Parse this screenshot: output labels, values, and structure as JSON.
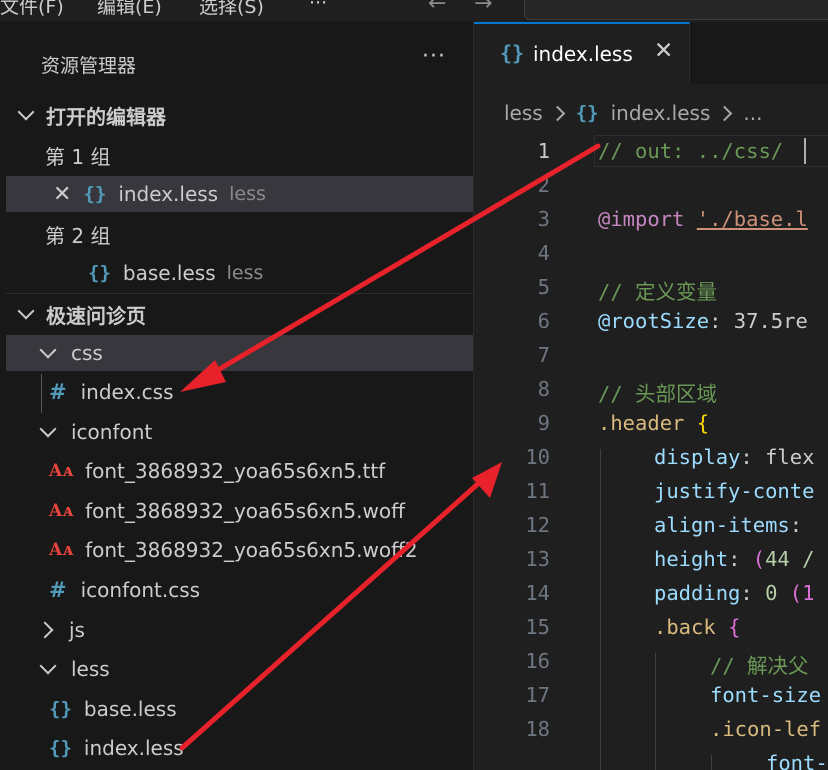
{
  "menubar": {
    "file": "文件(F)",
    "edit": "编辑(E)",
    "selection": "选择(S)",
    "more": "···",
    "back": "←",
    "forward": "→"
  },
  "sidebar": {
    "title": "资源管理器",
    "more": "···",
    "open_editors": {
      "header": "打开的编辑器",
      "group1": "第 1 组",
      "group1_file": {
        "name": "index.less",
        "desc": "less"
      },
      "group2": "第 2 组",
      "group2_file": {
        "name": "base.less",
        "desc": "less"
      }
    },
    "project": {
      "header": "极速问诊页",
      "items": [
        {
          "label": "css"
        },
        {
          "label": "index.css"
        },
        {
          "label": "iconfont"
        },
        {
          "label": "font_3868932_yoa65s6xn5.ttf"
        },
        {
          "label": "font_3868932_yoa65s6xn5.woff"
        },
        {
          "label": "font_3868932_yoa65s6xn5.woff2"
        },
        {
          "label": "iconfont.css"
        },
        {
          "label": "js"
        },
        {
          "label": "less"
        },
        {
          "label": "base.less"
        },
        {
          "label": "index.less"
        }
      ]
    }
  },
  "icons": {
    "braces": "{}",
    "hash": "#",
    "font": "Aᴀ",
    "close": "✕"
  },
  "editor": {
    "tab": {
      "label": "index.less",
      "close": "✕"
    },
    "breadcrumb": [
      "less",
      "index.less",
      "..."
    ],
    "lines": [
      {
        "n": "1"
      },
      {
        "n": "2"
      },
      {
        "n": "3"
      },
      {
        "n": "4"
      },
      {
        "n": "5"
      },
      {
        "n": "6"
      },
      {
        "n": "7"
      },
      {
        "n": "8"
      },
      {
        "n": "9"
      },
      {
        "n": "10"
      },
      {
        "n": "11"
      },
      {
        "n": "12"
      },
      {
        "n": "13"
      },
      {
        "n": "14"
      },
      {
        "n": "15"
      },
      {
        "n": "16"
      },
      {
        "n": "17"
      },
      {
        "n": "18"
      }
    ],
    "code": {
      "l1": "// out: ../css/",
      "l3_kw": "@import",
      "l3_str": "'./base.l",
      "l5": "// 定义变量",
      "l6_var": "@rootSize",
      "l6_rest": ": 37.5re",
      "l8": "// 头部区域",
      "l9_sel": ".header",
      "l9_brace": "{",
      "l10_prop": "display",
      "l10_val": ": flex",
      "l11_prop": "justify-conte",
      "l12_prop": "align-items",
      "l12_punc": ":",
      "l13_prop": "height",
      "l13_punc": ": ",
      "l13_paren": "(",
      "l13_num": "44 /",
      "l14_prop": "padding",
      "l14_punc": ": ",
      "l14_num": "0 ",
      "l14_paren": "(1",
      "l15_sel": ".back",
      "l15_brace": "{",
      "l16": "// 解决父",
      "l17_prop": "font-size",
      "l18_sel": ".icon-lef",
      "l19_prop": "font-"
    }
  },
  "colors": {
    "accent": "#0078d4",
    "arrow": "#e8222a",
    "selected_row": "#37373d"
  }
}
